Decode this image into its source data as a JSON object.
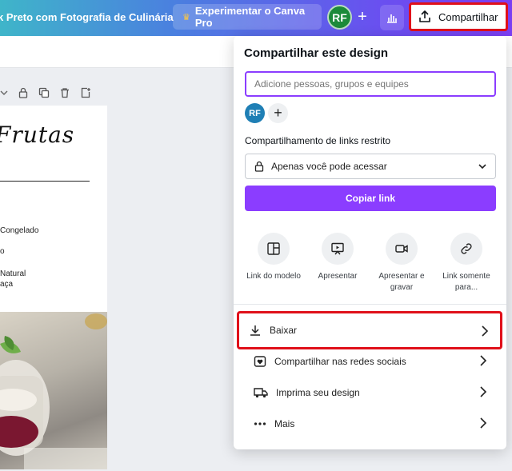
{
  "topbar": {
    "doc_title": "k Preto com Fotografia de Culinária",
    "try_pro_label": "Experimentar o Canva Pro",
    "avatar_initials": "RF",
    "share_label": "Compartilhar"
  },
  "canvas": {
    "script_title": "Frutas",
    "ingredients": [
      "Congelado",
      "o",
      "Natural",
      "aça"
    ]
  },
  "share_panel": {
    "title": "Compartilhar este design",
    "people_placeholder": "Adicione pessoas, grupos e equipes",
    "avatar_initials": "RF",
    "link_label": "Compartilhamento de links restrito",
    "access_value": "Apenas você pode acessar",
    "copy_link_label": "Copiar link",
    "options": [
      {
        "label": "Link do modelo",
        "icon": "template-icon"
      },
      {
        "label": "Apresentar",
        "icon": "present-icon"
      },
      {
        "label": "Apresentar e gravar",
        "icon": "record-icon"
      },
      {
        "label": "Link somente para...",
        "icon": "link-icon"
      }
    ],
    "actions": [
      {
        "label": "Baixar",
        "icon": "download-icon"
      },
      {
        "label": "Compartilhar nas redes sociais",
        "icon": "social-icon"
      },
      {
        "label": "Imprima seu design",
        "icon": "print-truck-icon"
      },
      {
        "label": "Mais",
        "icon": "more-icon"
      }
    ]
  },
  "colors": {
    "accent": "#8b3dff",
    "highlight": "#e0101a",
    "avatar_green": "#1c8a3a",
    "avatar_blue": "#1f7fb5"
  }
}
